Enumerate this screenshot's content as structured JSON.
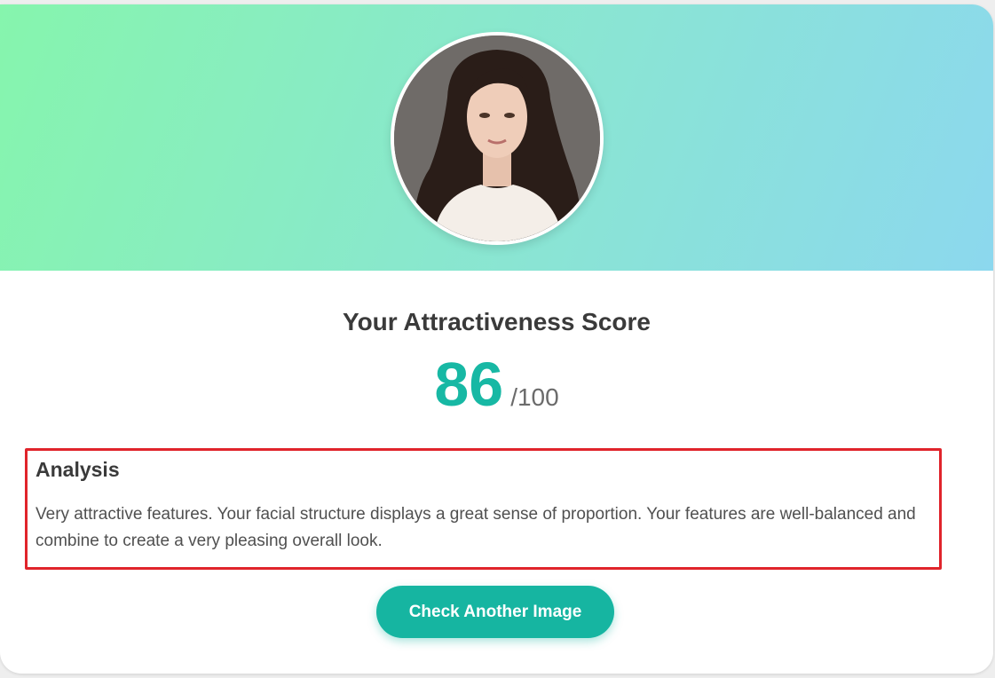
{
  "result": {
    "score_title": "Your Attractiveness Score",
    "score_value": "86",
    "score_max": "/100",
    "score": 86,
    "score_out_of": 100
  },
  "analysis": {
    "heading": "Analysis",
    "text": "Very attractive features. Your facial structure displays a great sense of proportion. Your features are well-balanced and combine to create a very pleasing overall look."
  },
  "actions": {
    "check_another_label": "Check Another Image"
  },
  "colors": {
    "accent": "#17b8a4",
    "highlight_border": "#e0242b",
    "banner_start": "#86f5ad",
    "banner_end": "#8cd8ee"
  }
}
